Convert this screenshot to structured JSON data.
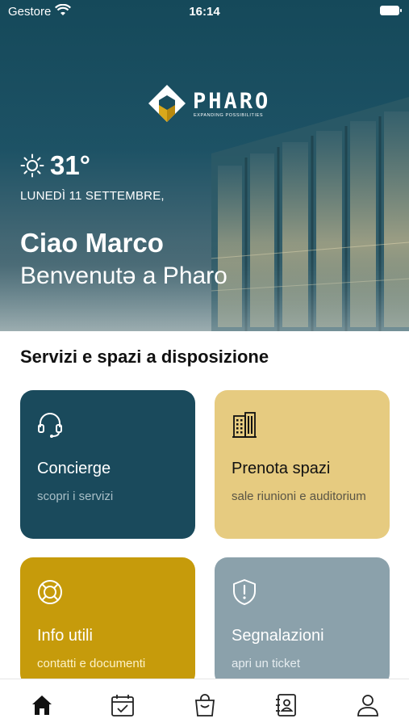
{
  "status_bar": {
    "carrier": "Gestore",
    "time": "16:14"
  },
  "brand": {
    "name": "PHARO",
    "tagline": "EXPANDING POSSIBILITIES"
  },
  "weather": {
    "temperature": "31°",
    "icon": "sun-icon"
  },
  "date": "LUNEDÌ 11 SETTEMBRE,",
  "greeting": "Ciao Marco",
  "welcome": "Benvenutə a Pharo",
  "section_title": "Servizi e spazi a disposizione",
  "tiles": [
    {
      "title": "Concierge",
      "subtitle": "scopri i servizi",
      "icon": "headset-icon",
      "color": "#1a4a5c"
    },
    {
      "title": "Prenota spazi",
      "subtitle": "sale riunioni e auditorium",
      "icon": "building-icon",
      "color": "#e6cb80"
    },
    {
      "title": "Info utili",
      "subtitle": "contatti e documenti",
      "icon": "lifebuoy-icon",
      "color": "#c69b0b"
    },
    {
      "title": "Segnalazioni",
      "subtitle": "apri un ticket",
      "icon": "shield-alert-icon",
      "color": "#8ba1ab"
    }
  ],
  "tabbar": {
    "items": [
      {
        "icon": "home-icon",
        "active": true
      },
      {
        "icon": "calendar-check-icon",
        "active": false
      },
      {
        "icon": "shopping-bag-icon",
        "active": false
      },
      {
        "icon": "contacts-book-icon",
        "active": false
      },
      {
        "icon": "user-icon",
        "active": false
      }
    ]
  },
  "colors": {
    "hero_dark": "#15495a",
    "accent_gold": "#c69b0b"
  }
}
